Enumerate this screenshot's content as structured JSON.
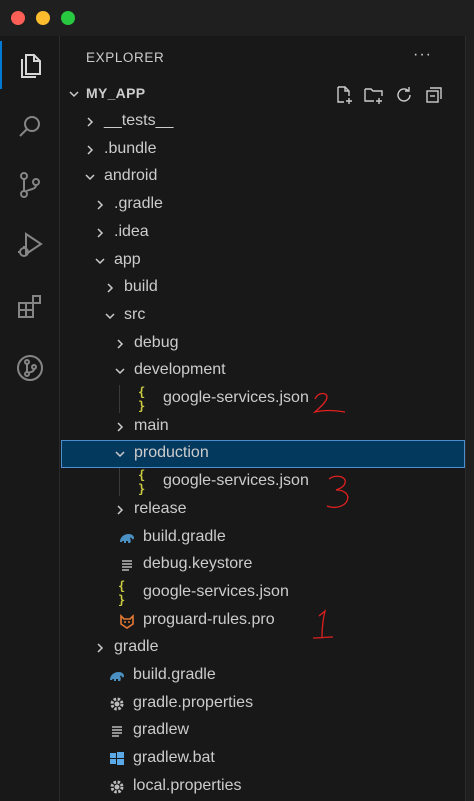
{
  "explorer": {
    "title": "EXPLORER",
    "more": "···"
  },
  "workspace": {
    "name": "MY_APP"
  },
  "tree": [
    {
      "label": "__tests__",
      "type": "folder",
      "expanded": false,
      "depth": 1
    },
    {
      "label": ".bundle",
      "type": "folder",
      "expanded": false,
      "depth": 1
    },
    {
      "label": "android",
      "type": "folder",
      "expanded": true,
      "depth": 1
    },
    {
      "label": ".gradle",
      "type": "folder",
      "expanded": false,
      "depth": 2
    },
    {
      "label": ".idea",
      "type": "folder",
      "expanded": false,
      "depth": 2
    },
    {
      "label": "app",
      "type": "folder",
      "expanded": true,
      "depth": 2
    },
    {
      "label": "build",
      "type": "folder",
      "expanded": false,
      "depth": 3
    },
    {
      "label": "src",
      "type": "folder",
      "expanded": true,
      "depth": 3
    },
    {
      "label": "debug",
      "type": "folder",
      "expanded": false,
      "depth": 4
    },
    {
      "label": "development",
      "type": "folder",
      "expanded": true,
      "depth": 4
    },
    {
      "label": "google-services.json",
      "type": "json",
      "depth": 5
    },
    {
      "label": "main",
      "type": "folder",
      "expanded": false,
      "depth": 4
    },
    {
      "label": "production",
      "type": "folder",
      "expanded": true,
      "depth": 4,
      "selected": true
    },
    {
      "label": "google-services.json",
      "type": "json",
      "depth": 5
    },
    {
      "label": "release",
      "type": "folder",
      "expanded": false,
      "depth": 4
    },
    {
      "label": "build.gradle",
      "type": "gradle",
      "depth": 3
    },
    {
      "label": "debug.keystore",
      "type": "text",
      "depth": 3
    },
    {
      "label": "google-services.json",
      "type": "json",
      "depth": 3
    },
    {
      "label": "proguard-rules.pro",
      "type": "proguard",
      "depth": 3
    },
    {
      "label": "gradle",
      "type": "folder",
      "expanded": false,
      "depth": 2
    },
    {
      "label": "build.gradle",
      "type": "gradle",
      "depth": 2
    },
    {
      "label": "gradle.properties",
      "type": "gear",
      "depth": 2
    },
    {
      "label": "gradlew",
      "type": "text",
      "depth": 2
    },
    {
      "label": "gradlew.bat",
      "type": "windows",
      "depth": 2
    },
    {
      "label": "local.properties",
      "type": "gear",
      "depth": 2
    }
  ],
  "icons": {
    "json": "{ }",
    "colors": {
      "json": "#cbcb41",
      "gradle": "#4a90c2",
      "proguard": "#e37933",
      "windows": "#5aa9e6",
      "gear": "#bbbbbb",
      "text": "#bbbbbb",
      "annotation": "#e02020",
      "accent": "#0078d4"
    }
  },
  "annotations": [
    "2",
    "3",
    "1"
  ]
}
